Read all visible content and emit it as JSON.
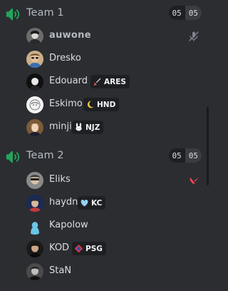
{
  "teams": [
    {
      "name": "Team 1",
      "count_left": "05",
      "count_right": "05",
      "members": [
        {
          "name": "auwone",
          "tag": "",
          "status": "muted"
        },
        {
          "name": "Dresko",
          "tag": ""
        },
        {
          "name": "Edouard",
          "tag": "ARES"
        },
        {
          "name": "Eskimo",
          "tag": "HND"
        },
        {
          "name": "minji",
          "tag": "NJZ"
        }
      ]
    },
    {
      "name": "Team 2",
      "count_left": "05",
      "count_right": "05",
      "members": [
        {
          "name": "Eliks",
          "tag": "",
          "status": "valorant"
        },
        {
          "name": "haydn",
          "tag": "KC"
        },
        {
          "name": "Kapolow",
          "tag": ""
        },
        {
          "name": "KOD",
          "tag": "PSG"
        },
        {
          "name": "StaN",
          "tag": ""
        }
      ]
    }
  ],
  "colors": {
    "background": "#2b2d31",
    "team_icon": "#23a55a",
    "text": "#dbdee1",
    "muted_text": "#b5bac1",
    "tag_bg": "#1e1f22",
    "valorant_red": "#ff4655"
  }
}
